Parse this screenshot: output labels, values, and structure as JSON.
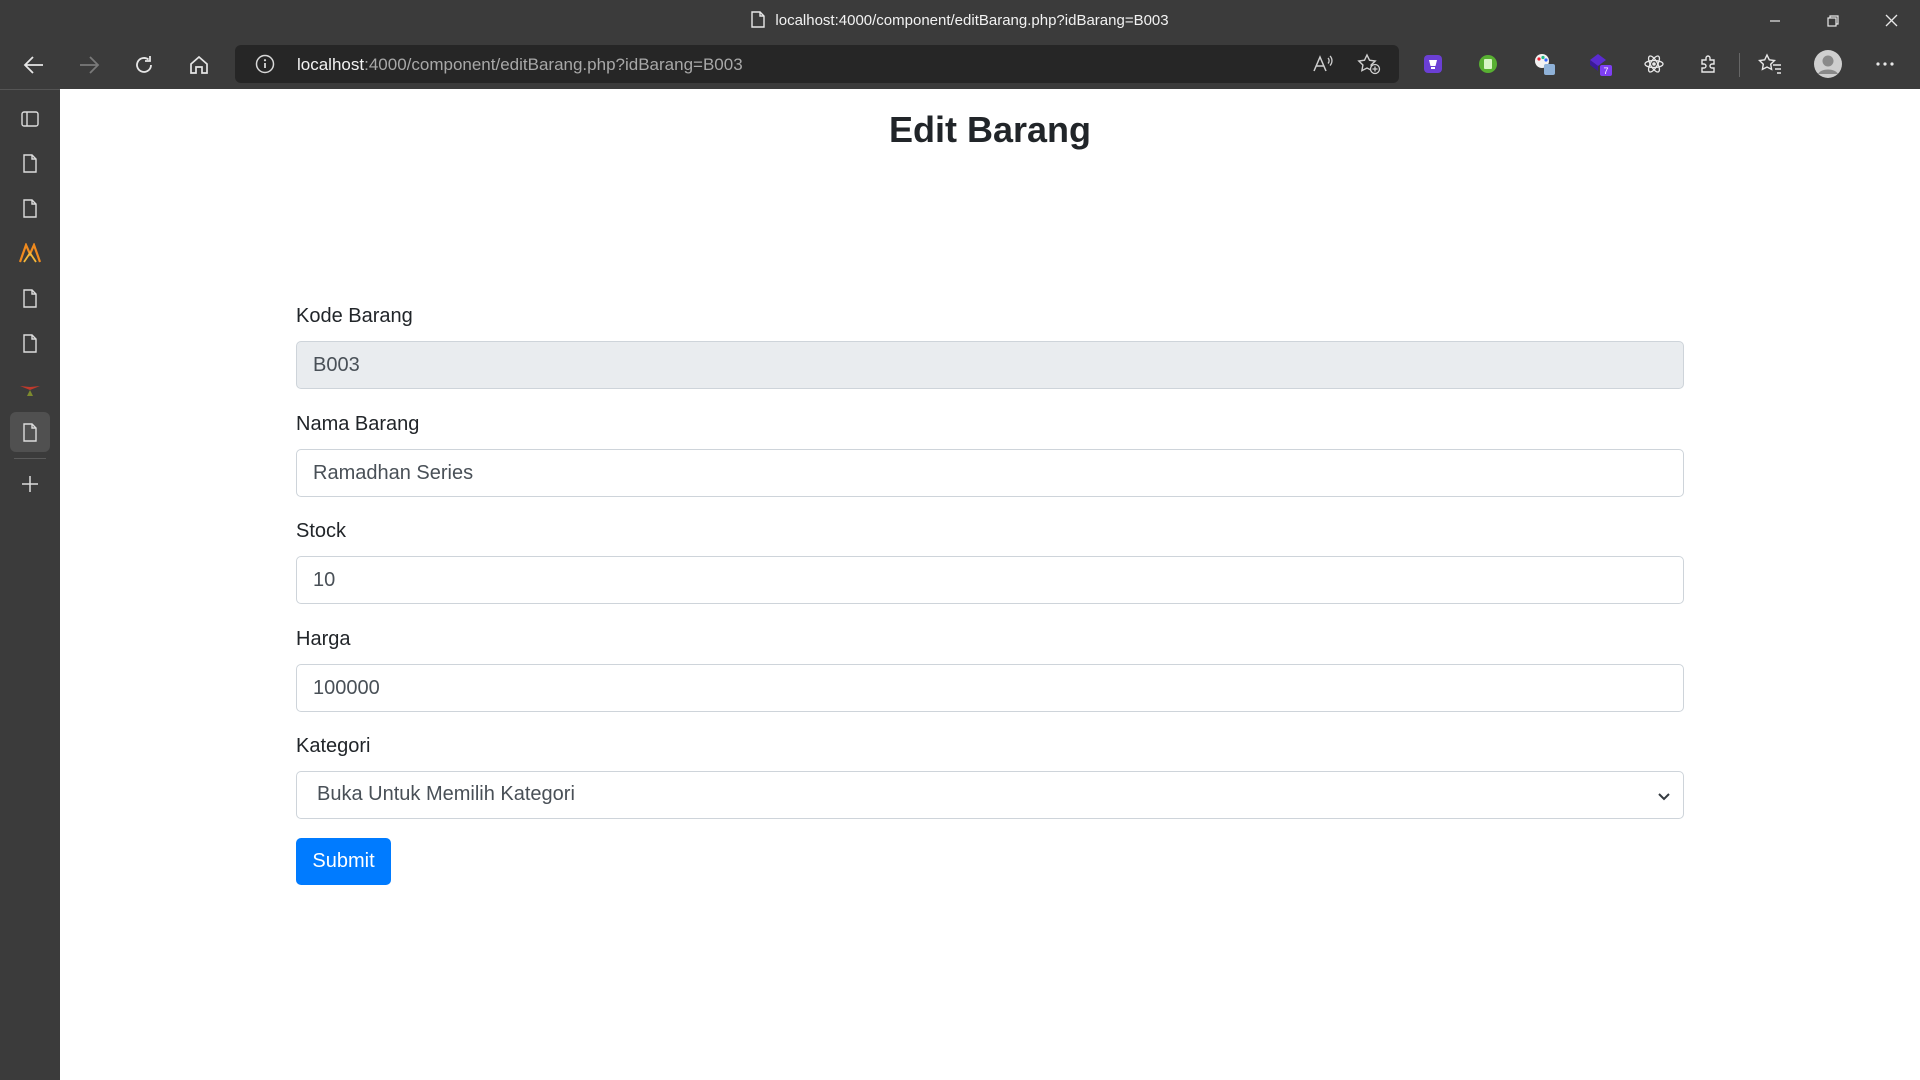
{
  "window": {
    "title": "localhost:4000/component/editBarang.php?idBarang=B003"
  },
  "address_bar": {
    "host": "localhost",
    "path": ":4000/component/editBarang.php?idBarang=B003"
  },
  "extensions": {
    "badge_count": "7"
  },
  "page": {
    "heading": "Edit Barang"
  },
  "form": {
    "kode_label": "Kode Barang",
    "kode_value": "B003",
    "nama_label": "Nama Barang",
    "nama_value": "Ramadhan Series",
    "stock_label": "Stock",
    "stock_value": "10",
    "harga_label": "Harga",
    "harga_value": "100000",
    "kategori_label": "Kategori",
    "kategori_selected": "Buka Untuk Memilih Kategori",
    "submit_label": "Submit"
  },
  "colors": {
    "primary": "#007bff",
    "readonly_bg": "#e9ecef",
    "chrome_bg": "#3b3b3b"
  }
}
